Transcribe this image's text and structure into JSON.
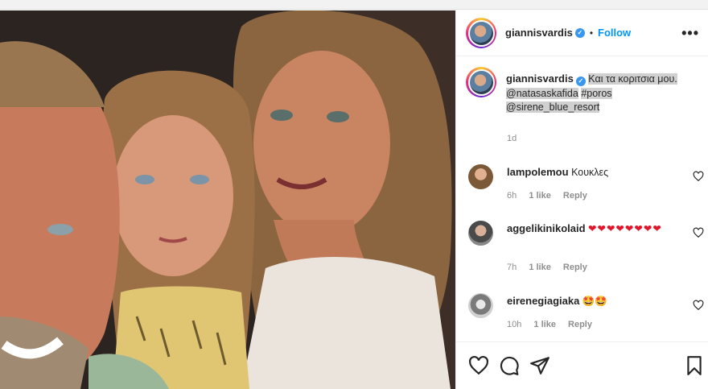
{
  "post": {
    "username": "giannisvardis",
    "follow_label": "Follow",
    "separator": "•",
    "more_label": "•••",
    "caption": {
      "text_main": "Και τα κοριτσια μου.",
      "mention1": "@natasaskafida",
      "hashtag": "#poros",
      "mention2": "@sirene_blue_resort",
      "time": "1d"
    }
  },
  "comments": [
    {
      "username": "lampolemou",
      "text": "Κουκλες",
      "time": "6h",
      "likes": "1 like",
      "reply": "Reply"
    },
    {
      "username": "aggelikinikolaid",
      "text": "❤❤❤❤❤❤❤❤",
      "time": "7h",
      "likes": "1 like",
      "reply": "Reply"
    },
    {
      "username": "eirenegiagiaka",
      "text": "🤩🤩",
      "time": "10h",
      "likes": "1 like",
      "reply": "Reply"
    }
  ],
  "icons": [
    "heart-icon",
    "comment-icon",
    "share-icon",
    "bookmark-icon",
    "verified-badge-icon",
    "more-options-icon"
  ],
  "colors": {
    "link": "#0095f6",
    "verified": "#3897f0",
    "heart": "#e0162b",
    "muted": "#8e8e8e"
  }
}
